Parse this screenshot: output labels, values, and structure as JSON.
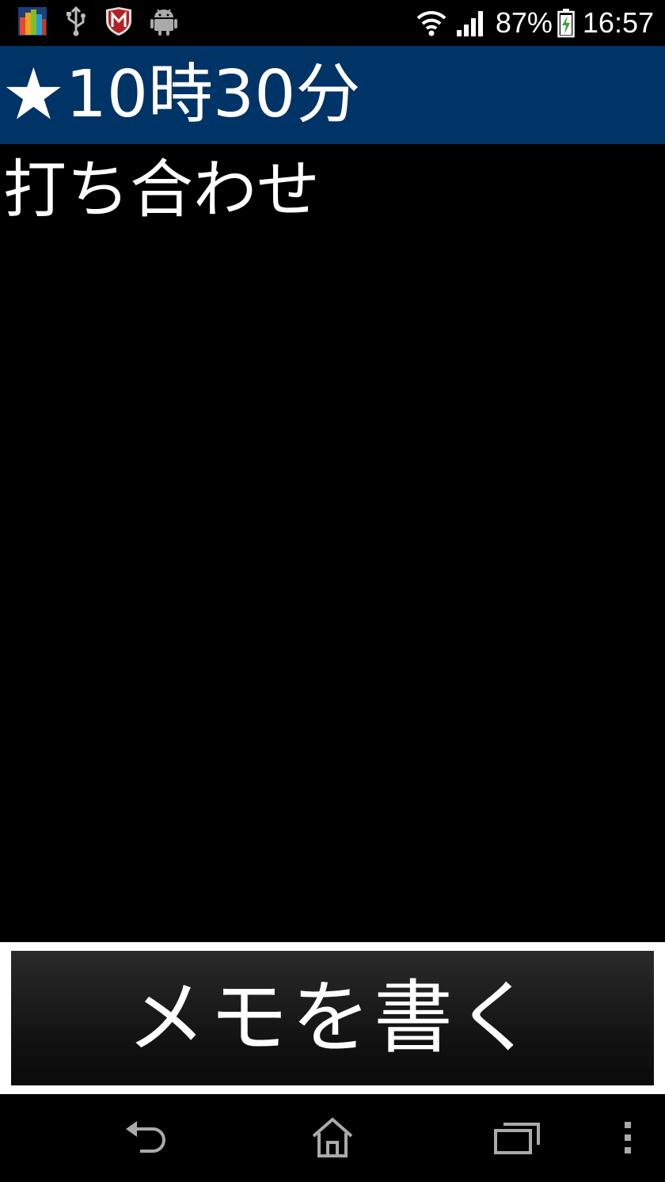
{
  "status_bar": {
    "battery_percent": "87%",
    "time": "16:57",
    "left_icons": [
      "avg-antivirus-icon",
      "usb-icon",
      "mcafee-icon",
      "android-debug-icon"
    ],
    "right_icons": [
      "wifi-icon",
      "signal-icon",
      "battery-charging-icon"
    ]
  },
  "header": {
    "star": "★",
    "title": "10時30分",
    "background_color": "#003366"
  },
  "memo": {
    "text": "打ち合わせ"
  },
  "write_button": {
    "label": "メモを書く"
  },
  "nav_bar": {
    "icons": [
      "back-icon",
      "home-icon",
      "recent-apps-icon",
      "menu-icon"
    ]
  }
}
